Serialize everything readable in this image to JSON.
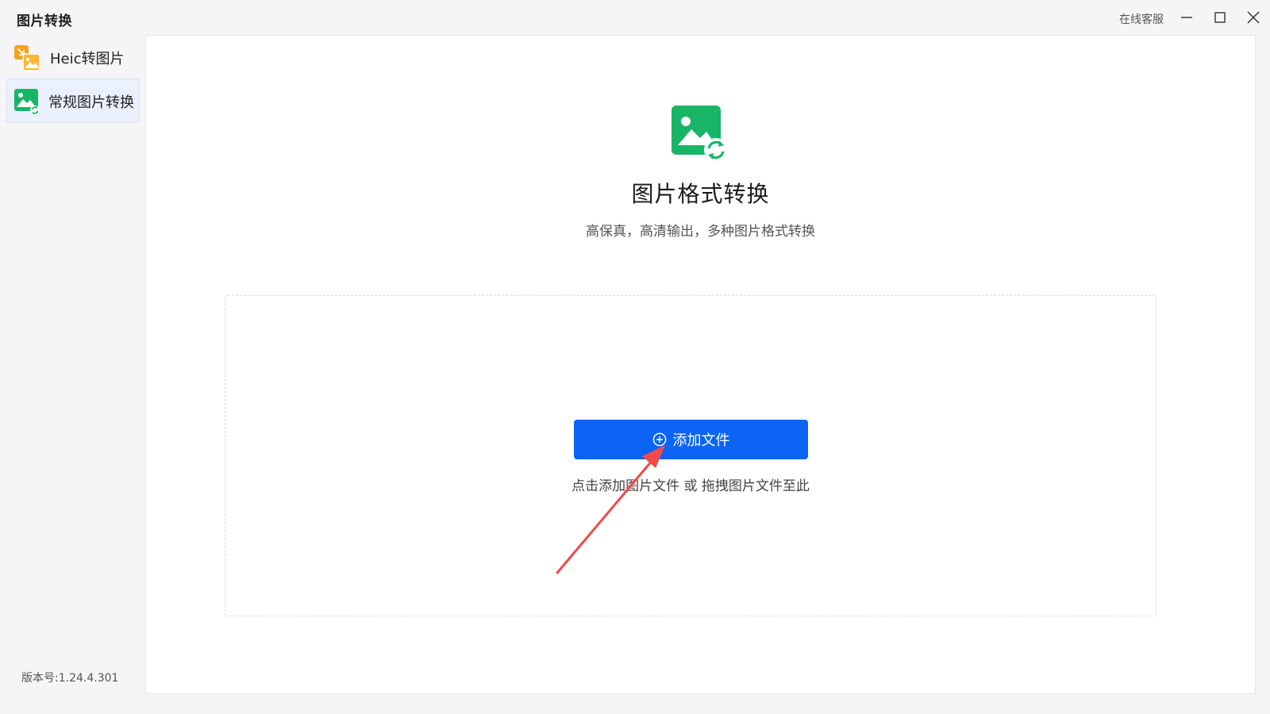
{
  "window": {
    "title": "图片转换",
    "support_label": "在线客服",
    "controls": [
      "minimize-icon",
      "maximize-icon",
      "close-icon"
    ]
  },
  "sidebar": {
    "items": [
      {
        "label": "Heic转图片",
        "icon": "heic-convert-icon",
        "active": false
      },
      {
        "label": "常规图片转换",
        "icon": "image-convert-icon",
        "active": true
      }
    ],
    "version": "版本号:1.24.4.301"
  },
  "main": {
    "icon": "image-convert-icon",
    "title": "图片格式转换",
    "subtitle": "高保真，高清输出，多种图片格式转换",
    "add_button_label": "添加文件",
    "add_button_icon": "plus-circle-icon",
    "drop_hint": "点击添加图片文件 或 拖拽图片文件至此"
  },
  "colors": {
    "primary": "#0b64f4",
    "green_icon": "#18b566",
    "orange_icon": "#f7a21b",
    "annotation_arrow": "#f04a4a"
  }
}
